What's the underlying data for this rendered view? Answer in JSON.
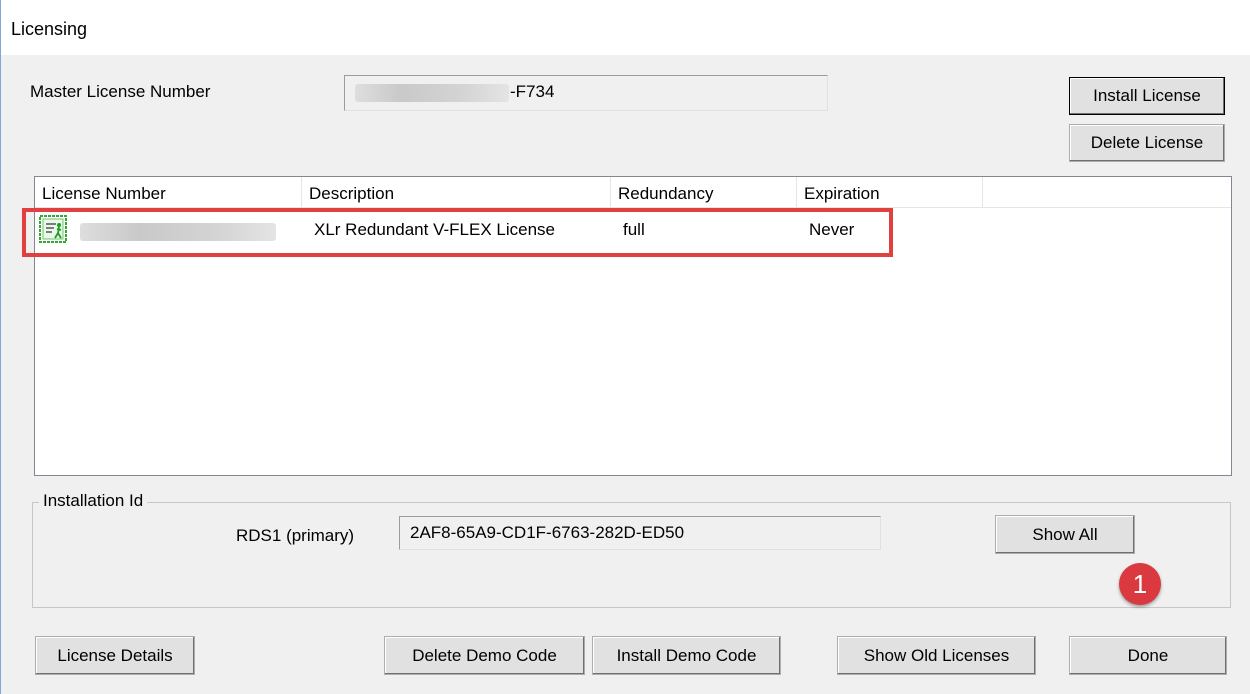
{
  "window": {
    "title": "Licensing"
  },
  "master_license": {
    "label": "Master License Number",
    "value_suffix": "-F734"
  },
  "buttons": {
    "install_license": "Install License",
    "delete_license": "Delete License",
    "show_all": "Show All",
    "license_details": "License Details",
    "delete_demo_code": "Delete Demo Code",
    "install_demo_code": "Install Demo Code",
    "show_old_licenses": "Show Old Licenses",
    "done": "Done"
  },
  "license_table": {
    "columns": [
      "License Number",
      "Description",
      "Redundancy",
      "Expiration"
    ],
    "rows": [
      {
        "license_number": "",
        "description": "XLr Redundant V-FLEX License",
        "redundancy": "full",
        "expiration": "Never",
        "icon": "license-icon"
      }
    ]
  },
  "installation_id": {
    "group_title": "Installation Id",
    "label": "RDS1 (primary)",
    "value": "2AF8-65A9-CD1F-6763-282D-ED50"
  },
  "annotation": {
    "step_number": "1",
    "color": "#d9393f"
  },
  "highlight_color": "#e04040"
}
